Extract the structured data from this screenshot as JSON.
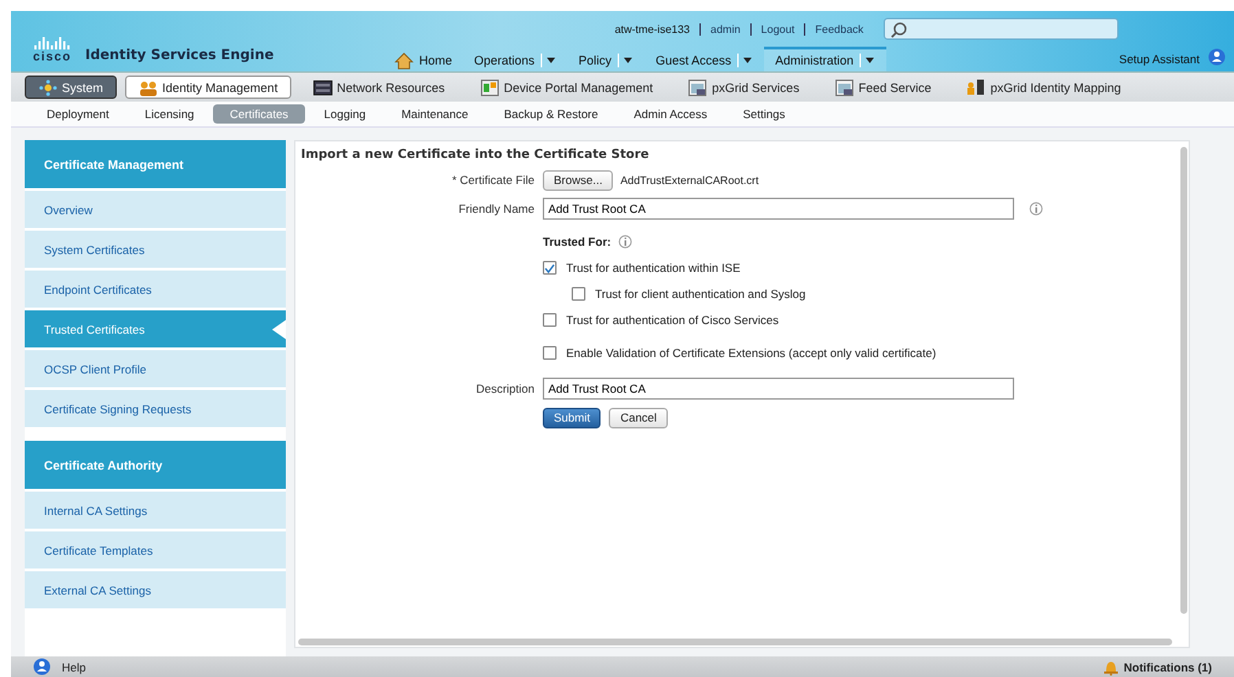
{
  "header": {
    "logo_text": "cisco",
    "product": "Identity Services Engine",
    "user_links": [
      {
        "label": "atw-tme-ise133",
        "kind": "text"
      },
      {
        "label": "admin",
        "kind": "link"
      },
      {
        "label": "Logout",
        "kind": "link"
      },
      {
        "label": "Feedback",
        "kind": "link"
      }
    ],
    "main_nav": [
      {
        "label": "Home",
        "kind": "home",
        "selected": false
      },
      {
        "label": "Operations",
        "kind": "menu",
        "selected": false
      },
      {
        "label": "Policy",
        "kind": "menu",
        "selected": false
      },
      {
        "label": "Guest Access",
        "kind": "menu",
        "selected": false
      },
      {
        "label": "Administration",
        "kind": "menu",
        "selected": true
      }
    ],
    "setup_assistant": "Setup Assistant"
  },
  "section_tabs": [
    {
      "label": "System",
      "selected": true,
      "outlined": false
    },
    {
      "label": "Identity Management",
      "selected": false,
      "outlined": true
    },
    {
      "label": "Network Resources",
      "selected": false,
      "outlined": false
    },
    {
      "label": "Device Portal Management",
      "selected": false,
      "outlined": false
    },
    {
      "label": "pxGrid Services",
      "selected": false,
      "outlined": false
    },
    {
      "label": "Feed Service",
      "selected": false,
      "outlined": false
    },
    {
      "label": "pxGrid Identity Mapping",
      "selected": false,
      "outlined": false
    }
  ],
  "sub_tabs": [
    {
      "label": "Deployment",
      "selected": false
    },
    {
      "label": "Licensing",
      "selected": false
    },
    {
      "label": "Certificates",
      "selected": true
    },
    {
      "label": "Logging",
      "selected": false
    },
    {
      "label": "Maintenance",
      "selected": false
    },
    {
      "label": "Backup & Restore",
      "selected": false
    },
    {
      "label": "Admin Access",
      "selected": false
    },
    {
      "label": "Settings",
      "selected": false
    }
  ],
  "sidebar": {
    "sections": [
      {
        "title": "Certificate Management",
        "items": [
          {
            "label": "Overview",
            "selected": false
          },
          {
            "label": "System Certificates",
            "selected": false
          },
          {
            "label": "Endpoint Certificates",
            "selected": false
          },
          {
            "label": "Trusted Certificates",
            "selected": true
          },
          {
            "label": "OCSP Client Profile",
            "selected": false
          },
          {
            "label": "Certificate Signing Requests",
            "selected": false
          }
        ]
      },
      {
        "title": "Certificate Authority",
        "items": [
          {
            "label": "Internal CA Settings",
            "selected": false
          },
          {
            "label": "Certificate Templates",
            "selected": false
          },
          {
            "label": "External CA Settings",
            "selected": false
          }
        ]
      }
    ]
  },
  "form": {
    "title": "Import a new Certificate into the Certificate Store",
    "file_label": "* Certificate File",
    "browse": "Browse...",
    "file_name": "AddTrustExternalCARoot.crt",
    "friendly_label": "Friendly Name",
    "friendly_value": "Add Trust Root CA",
    "trusted_for": "Trusted For:",
    "options": [
      {
        "label": "Trust for authentication within ISE",
        "checked": true,
        "indented": false
      },
      {
        "label": "Trust for client authentication and Syslog",
        "checked": false,
        "indented": true
      },
      {
        "label": "Trust for authentication of Cisco Services",
        "checked": false,
        "indented": false
      },
      {
        "label": "Enable Validation of Certificate Extensions (accept only valid certificate)",
        "checked": false,
        "indented": false
      }
    ],
    "description_label": "Description",
    "description_value": "Add Trust Root CA",
    "buttons": [
      {
        "label": "Submit",
        "kind": "primary"
      },
      {
        "label": "Cancel",
        "kind": "secondary"
      }
    ]
  },
  "footer": {
    "help": "Help",
    "notifications": "Notifications (1)"
  }
}
